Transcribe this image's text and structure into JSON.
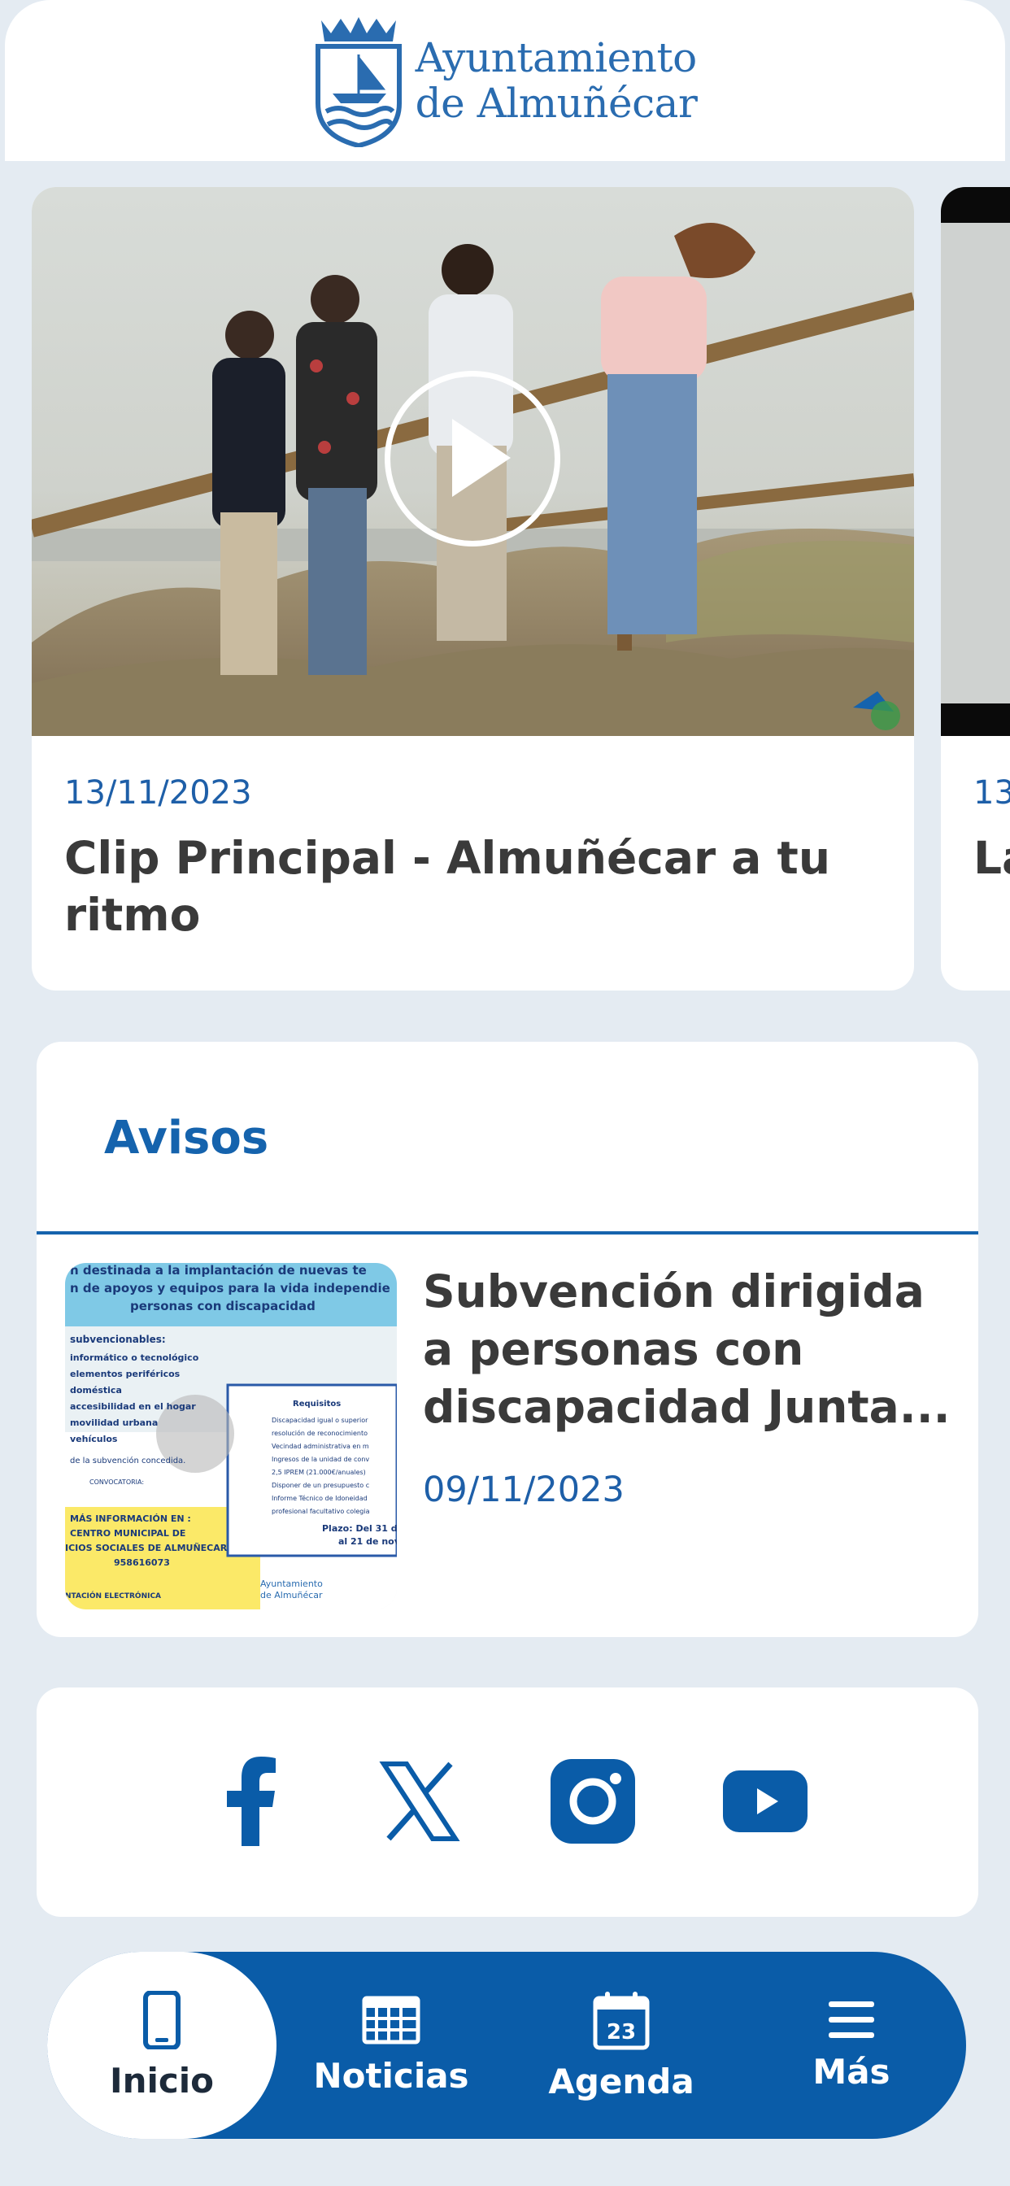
{
  "header": {
    "logo_line1": "Ayuntamiento",
    "logo_line2": "de Almuñécar"
  },
  "videos": [
    {
      "date": "13/11/2023",
      "title": "Clip Principal - Almuñécar a tu ritmo"
    },
    {
      "date": "13/",
      "title": "La"
    }
  ],
  "avisos": {
    "title": "Avisos",
    "items": [
      {
        "title": "Subvención dirigida a personas con discapacidad Junta...",
        "date": "09/11/2023",
        "image_text": {
          "line1": "n destinada a la implantación de nuevas te",
          "line2": "n de apoyos y equipos para la vida independie",
          "line3": "personas con discapacidad",
          "subv": "subvencionables:",
          "bullets": [
            "informático o tecnológico",
            "elementos periféricos",
            "doméstica",
            "accesibilidad en el hogar",
            "movilidad urbana",
            "vehículos"
          ],
          "subv_note": "de la subvención concedida.",
          "req_title": "Requisitos",
          "req_lines": [
            "Discapacidad igual o superior",
            "resolución de reconocimiento",
            "Vecindad administrativa en m",
            "Ingresos de la unidad de conv",
            "2,5 IPREM (21.000€/anuales)",
            "Disponer de un presupuesto c",
            "Informe Técnico de Idoneidad",
            "profesional facultativo colegia"
          ],
          "convocatoria": "CONVOCATORIA:",
          "plazo": "Plazo: Del 31 d",
          "plazo2": "al 21 de nov",
          "info1": "MÁS INFORMACIÓN EN :",
          "info2": "CENTRO MUNICIPAL DE",
          "info3": "ICIOS SOCIALES DE ALMUÑECAR",
          "info4": "958616073",
          "info5": "NTACIÓN ELECTRÓNICA",
          "logo1": "Ayuntamiento",
          "logo2": "de Almuñécar"
        }
      }
    ]
  },
  "social": [
    "facebook",
    "x",
    "instagram",
    "youtube"
  ],
  "tabs": [
    {
      "label": "Inicio",
      "icon": "phone-icon",
      "active": true
    },
    {
      "label": "Noticias",
      "icon": "newspaper-icon",
      "active": false
    },
    {
      "label": "Agenda",
      "icon": "calendar-icon",
      "active": false,
      "icon_text": "23"
    },
    {
      "label": "Más",
      "icon": "menu-icon",
      "active": false
    }
  ],
  "colors": {
    "brand": "#0a5ca8",
    "background": "#e4ebf2",
    "date": "#1e5fa8"
  }
}
